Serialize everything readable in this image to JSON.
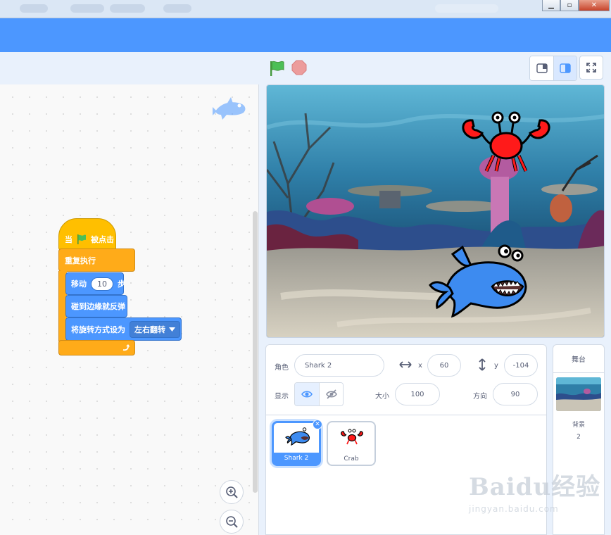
{
  "blocks": {
    "hat_prefix": "当",
    "hat_suffix": "被点击",
    "forever": "重复执行",
    "move_label": "移动",
    "move_steps": "10",
    "move_unit": "步",
    "bounce": "碰到边缘就反弹",
    "rotation_label": "将旋转方式设为",
    "rotation_value": "左右翻转"
  },
  "sprite_info": {
    "sprite_label": "角色",
    "sprite_name": "Shark 2",
    "x_label": "x",
    "x_value": "60",
    "y_label": "y",
    "y_value": "-104",
    "show_label": "显示",
    "size_label": "大小",
    "size_value": "100",
    "direction_label": "方向",
    "direction_value": "90"
  },
  "sprites": [
    {
      "name": "Shark 2",
      "selected": true
    },
    {
      "name": "Crab",
      "selected": false
    }
  ],
  "stage_panel": {
    "title": "舞台",
    "backdrop_label": "背景",
    "backdrop_count": "2"
  },
  "watermark": {
    "brand": "Baidu经验",
    "url": "jingyan.baidu.com"
  },
  "colors": {
    "menu_bar": "#4c97ff",
    "events": "#ffbf00",
    "control": "#ffab19",
    "motion": "#4c97ff",
    "green_flag": "#4cbf56",
    "stop": "#ec9c9c"
  },
  "icons": {
    "green_flag": "flag-icon",
    "stop": "stop-icon",
    "small_stage": "small-stage-icon",
    "normal_stage": "normal-stage-icon",
    "fullscreen": "fullscreen-icon",
    "zoom_in": "zoom-in-icon",
    "zoom_out": "zoom-out-icon",
    "show": "eye-icon",
    "hide": "eye-slash-icon"
  }
}
